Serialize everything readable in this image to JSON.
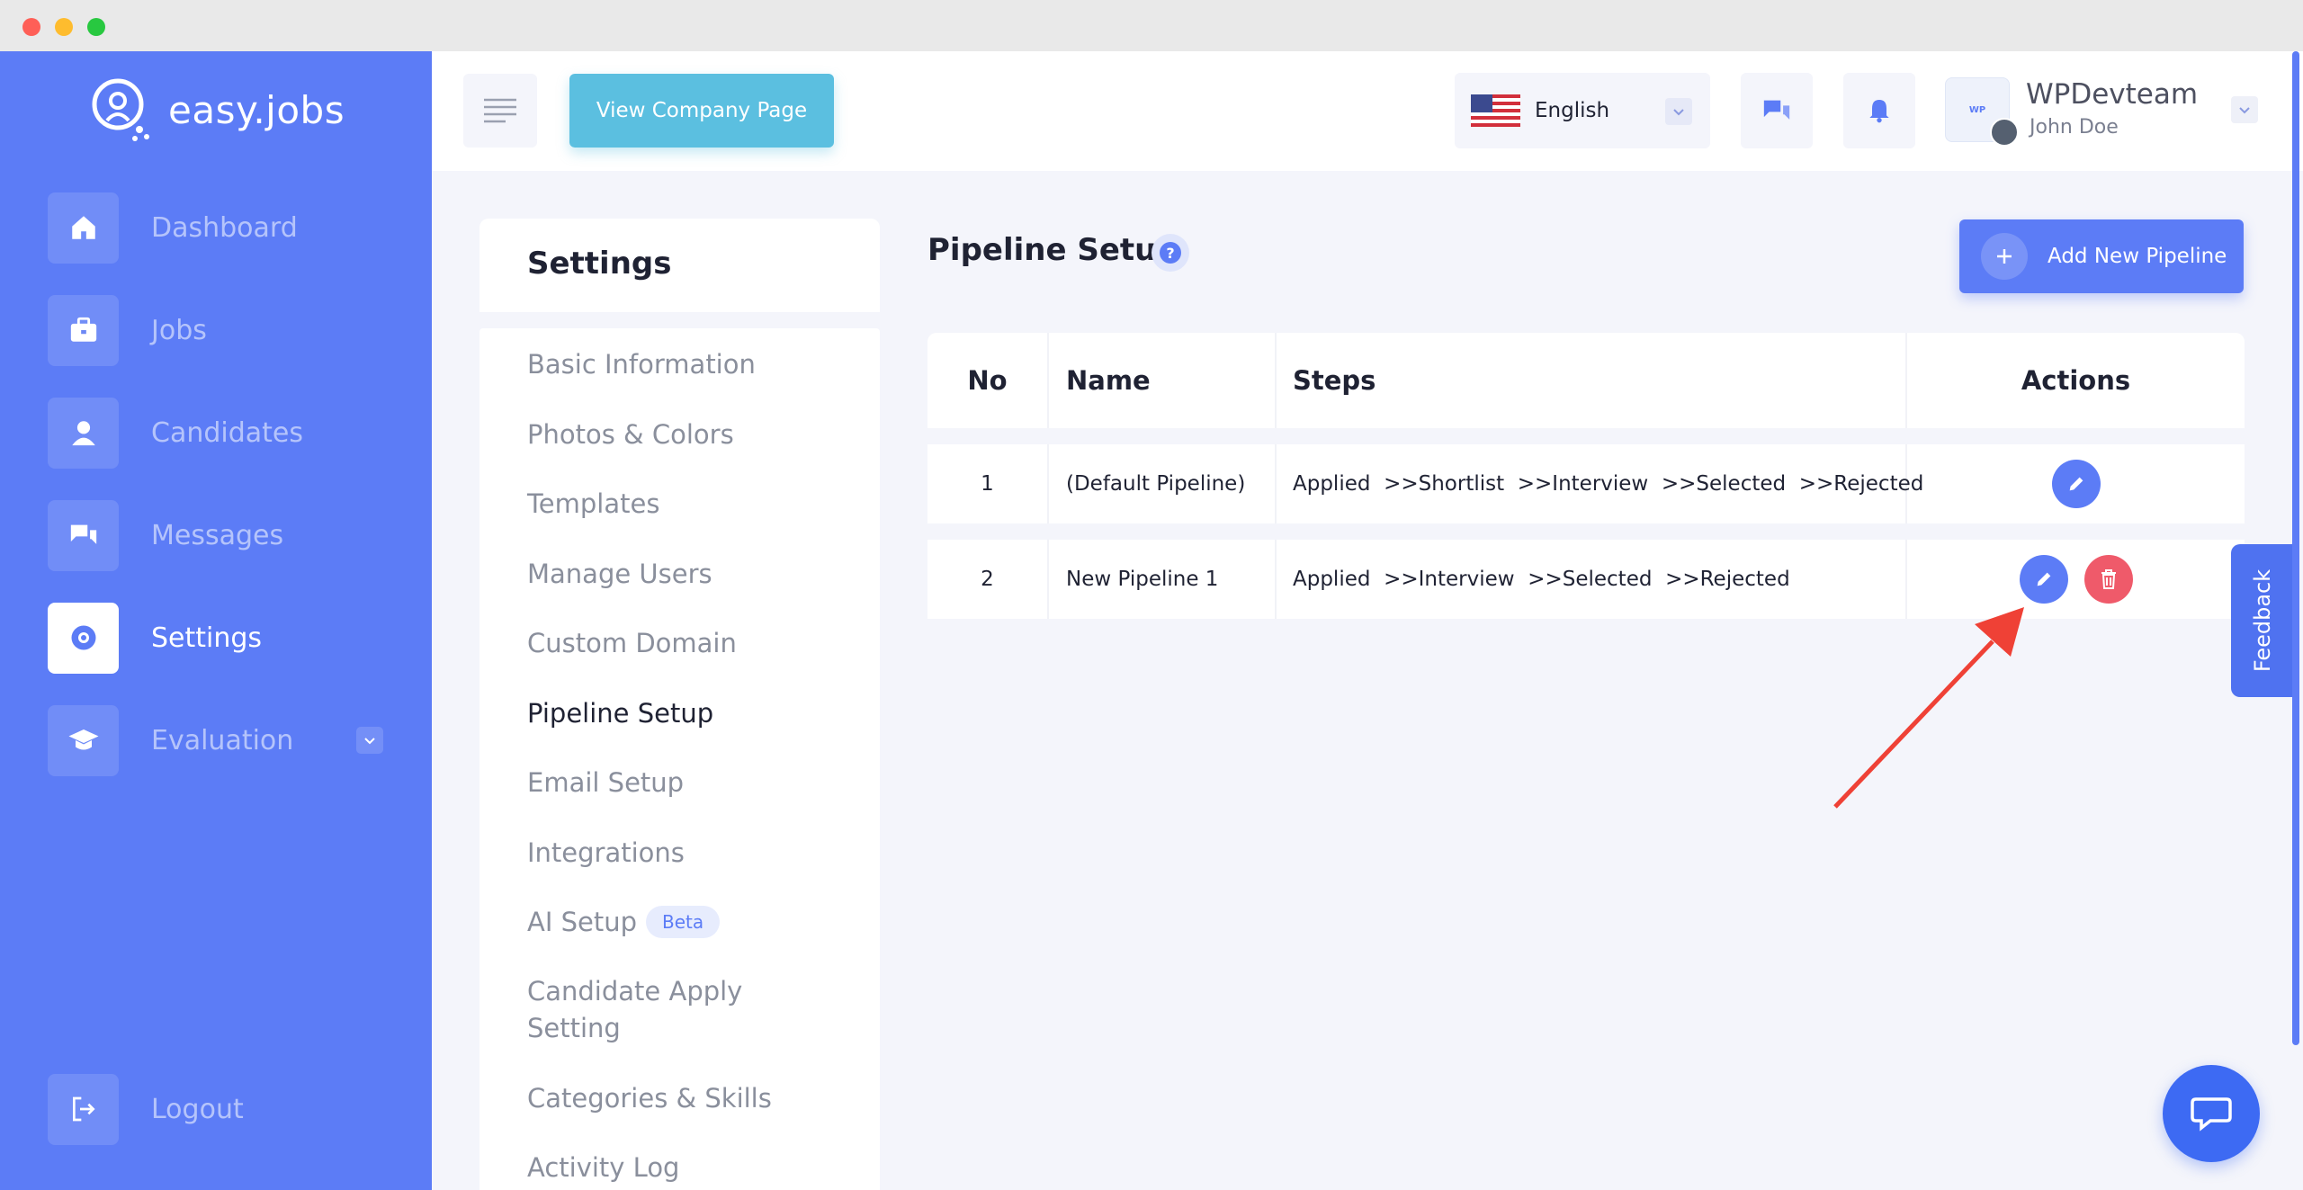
{
  "app": {
    "logo_text": "easy.jobs"
  },
  "sidebar": {
    "items": [
      {
        "label": "Dashboard",
        "icon": "home-icon"
      },
      {
        "label": "Jobs",
        "icon": "briefcase-icon"
      },
      {
        "label": "Candidates",
        "icon": "user-icon"
      },
      {
        "label": "Messages",
        "icon": "chat-icon"
      },
      {
        "label": "Settings",
        "icon": "gear-icon",
        "active": true
      },
      {
        "label": "Evaluation",
        "icon": "graduation-cap-icon"
      }
    ],
    "logout_label": "Logout"
  },
  "header": {
    "view_company_label": "View Company Page",
    "language": "English",
    "company_name": "WPDevteam",
    "user_name": "John Doe",
    "company_logo_text": "WP"
  },
  "settings": {
    "title": "Settings",
    "menu": [
      "Basic Information",
      "Photos & Colors",
      "Templates",
      "Manage Users",
      "Custom Domain",
      "Pipeline Setup",
      "Email Setup",
      "Integrations",
      "AI Setup",
      "Candidate Apply Setting",
      "Categories & Skills",
      "Activity Log"
    ],
    "active_item": "Pipeline Setup",
    "beta_badge": "Beta"
  },
  "pipeline": {
    "title": "Pipeline Setup",
    "help_glyph": "?",
    "add_label": "Add New Pipeline",
    "columns": [
      "No",
      "Name",
      "Steps",
      "Actions"
    ],
    "rows": [
      {
        "no": "1",
        "name": "(Default Pipeline)",
        "steps": "Applied  >>Shortlist  >>Interview  >>Selected  >>Rejected"
      },
      {
        "no": "2",
        "name": "New Pipeline 1",
        "steps": "Applied  >>Interview  >>Selected  >>Rejected"
      }
    ]
  },
  "feedback_label": "Feedback",
  "colors": {
    "brand": "#5c7cf6",
    "company_button": "#5bbfe0",
    "delete": "#ef5a6a",
    "annotation_arrow": "#ef4136"
  }
}
